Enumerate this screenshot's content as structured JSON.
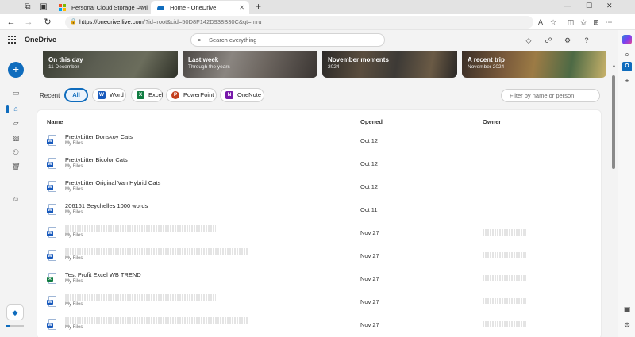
{
  "browser": {
    "tabs": [
      {
        "label": "Personal Cloud Storage – Microso",
        "active": false
      },
      {
        "label": "Home - OneDrive",
        "active": true
      }
    ],
    "url_host": "https://onedrive.live.com",
    "url_rest": "/?id=root&cid=50D8F142D938B30C&qt=mru",
    "icons": [
      "workspaces-icon",
      "tab-actions-icon",
      "back-icon",
      "forward-icon",
      "refresh-icon",
      "home-icon",
      "read-aloud-icon",
      "favorite-icon",
      "split-screen-icon",
      "favorites-icon",
      "collections-icon",
      "extensions-icon",
      "more-icon"
    ]
  },
  "header": {
    "app_name": "OneDrive",
    "search_placeholder": "Search everything"
  },
  "memories": [
    {
      "title": "On this day",
      "subtitle": "11 December"
    },
    {
      "title": "Last week",
      "subtitle": "Through the years"
    },
    {
      "title": "November moments",
      "subtitle": "2024"
    },
    {
      "title": "A recent trip",
      "subtitle": "November 2024"
    }
  ],
  "filters": {
    "label": "Recent",
    "chips": [
      "All",
      "Word",
      "Excel",
      "PowerPoint",
      "OneNote"
    ],
    "search_placeholder": "Filter by name or person"
  },
  "table": {
    "columns": [
      "Name",
      "Opened",
      "Owner"
    ],
    "rows": [
      {
        "name": "PrettyLitter Donskoy Cats",
        "location": "My Files",
        "opened": "Oct 12",
        "type": "word",
        "redacted": false
      },
      {
        "name": "PrettyLitter Bicolor Cats",
        "location": "My Files",
        "opened": "Oct 12",
        "type": "word",
        "redacted": false
      },
      {
        "name": "PrettyLitter Original Van Hybrid Cats",
        "location": "My Files",
        "opened": "Oct 12",
        "type": "word",
        "redacted": false
      },
      {
        "name": "206161 Seychelles 1000 words",
        "location": "My Files",
        "opened": "Oct 11",
        "type": "word",
        "redacted": false
      },
      {
        "name": "",
        "location": "My Files",
        "opened": "Nov 27",
        "type": "word",
        "redacted": true
      },
      {
        "name": "",
        "location": "My Files",
        "opened": "Nov 27",
        "type": "word",
        "redacted": true
      },
      {
        "name": "Test Profit Excel WB TREND",
        "location": "My Files",
        "opened": "Nov 27",
        "type": "excel",
        "redacted": false
      },
      {
        "name": "",
        "location": "My Files",
        "opened": "Nov 27",
        "type": "word",
        "redacted": true
      },
      {
        "name": "",
        "location": "My Files",
        "opened": "Nov 27",
        "type": "word",
        "redacted": true
      }
    ]
  },
  "colors": {
    "accent": "#0f6cbd",
    "word": "#185abd",
    "excel": "#107c41",
    "powerpoint": "#c43e1c",
    "onenote": "#7719aa"
  }
}
